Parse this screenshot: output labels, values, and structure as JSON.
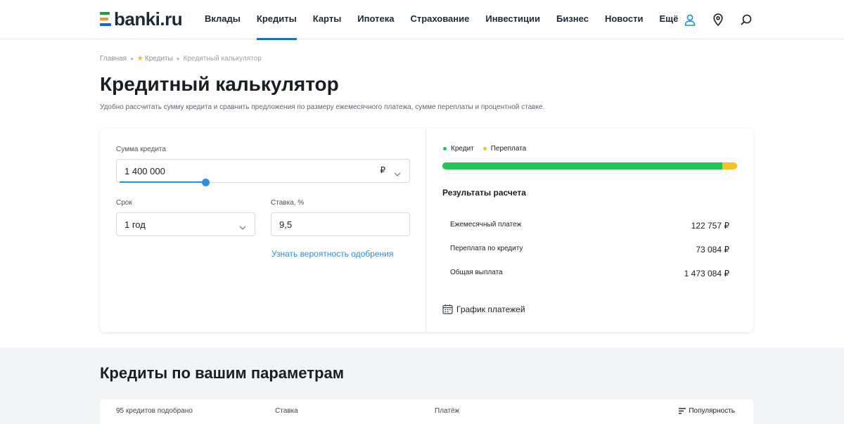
{
  "header": {
    "logo_text": "banki.ru",
    "nav": [
      {
        "label": "Вклады",
        "active": false
      },
      {
        "label": "Кредиты",
        "active": true
      },
      {
        "label": "Карты",
        "active": false
      },
      {
        "label": "Ипотека",
        "active": false
      },
      {
        "label": "Страхование",
        "active": false
      },
      {
        "label": "Инвестиции",
        "active": false
      },
      {
        "label": "Бизнес",
        "active": false
      },
      {
        "label": "Новости",
        "active": false
      },
      {
        "label": "Ещё",
        "active": false
      }
    ],
    "icons": [
      "user-icon",
      "location-pin-icon",
      "search-icon"
    ]
  },
  "breadcrumb": {
    "home": "Главная",
    "section": "Кредиты",
    "current": "Кредитный калькулятор"
  },
  "page": {
    "title": "Кредитный калькулятор",
    "subtitle": "Удобно рассчитать сумму кредита и сравнить предложения по размеру ежемесячного платежа, сумме переплаты и процентной ставке."
  },
  "calculator": {
    "amount_label": "Сумма кредита",
    "amount_value": "1 400 000",
    "currency": "₽",
    "amount_slider_fraction": 0.31,
    "term_label": "Срок",
    "term_value": "1 год",
    "rate_label": "Ставка, %",
    "rate_value": "9,5",
    "approval_link": "Узнать вероятность одобрения"
  },
  "results": {
    "legend_credit": "Кредит",
    "legend_overpay": "Переплата",
    "credit_color": "#23c25b",
    "overpay_color": "#f3c224",
    "credit_share": 0.9504,
    "title": "Результаты расчета",
    "rows": [
      {
        "label": "Ежемесячный платеж",
        "value": "122 757 ₽"
      },
      {
        "label": "Переплата по кредиту",
        "value": "73 084 ₽"
      },
      {
        "label": "Общая выплата",
        "value": "1 473 084 ₽"
      }
    ],
    "schedule_link": "График платежей"
  },
  "offers": {
    "title": "Кредиты по вашим параметрам",
    "count_text": "95 кредитов подобрано",
    "col_rate": "Ставка",
    "col_payment": "Платёж",
    "sort_label": "Популярность"
  }
}
